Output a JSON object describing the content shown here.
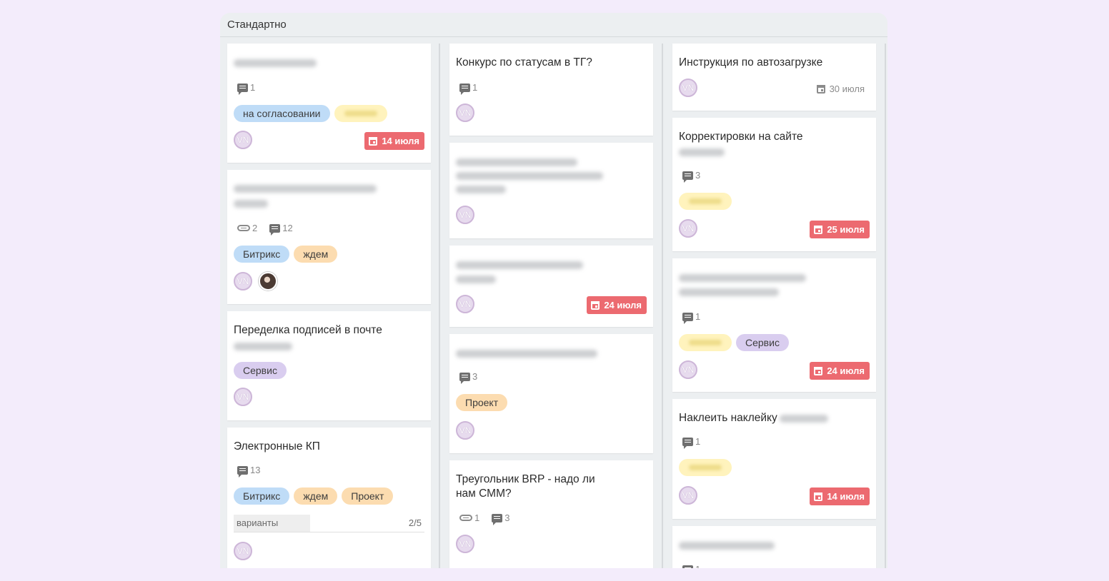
{
  "board": {
    "title": "Стандартно"
  },
  "icons": [
    "comment-icon",
    "paperclip-icon",
    "calendar-icon",
    "avatar"
  ],
  "colors": {
    "due_badge": "#ec6a70",
    "tag_blue": "#bfdcf7",
    "tag_orange": "#fcdcb0",
    "tag_purple": "#d9cdef",
    "tag_yellow": "#fff3bd"
  },
  "columns": [
    {
      "cards": [
        {
          "comments": "1",
          "tags": [
            "на согласовании"
          ],
          "avatar": "VN",
          "due": "14 июля"
        },
        {
          "attachments": "2",
          "comments": "12",
          "tags": [
            "Битрикс",
            "ждем"
          ],
          "avatar": "VN"
        },
        {
          "title": "Переделка подписей в почте",
          "tags": [
            "Сервис"
          ],
          "avatar": "VN"
        },
        {
          "title": "Электронные КП",
          "comments": "13",
          "tags": [
            "Битрикс",
            "ждем",
            "Проект"
          ],
          "checklist": {
            "label": "варианты",
            "count": "2/5",
            "progress": 0.4
          },
          "avatar": "VN"
        }
      ]
    },
    {
      "cards": [
        {
          "title": "Конкурс по статусам в ТГ?",
          "comments": "1",
          "avatar": "VN"
        },
        {
          "avatar": "VN"
        },
        {
          "avatar": "VN",
          "due": "24 июля"
        },
        {
          "comments": "3",
          "tags": [
            "Проект"
          ],
          "avatar": "VN"
        },
        {
          "title": "Треугольник BRP - надо ли нам СММ?",
          "attachments": "1",
          "comments": "3",
          "avatar": "VN"
        }
      ]
    },
    {
      "cards": [
        {
          "title": "Инструкция по автозагрузке",
          "avatar": "VN",
          "due": "30 июля"
        },
        {
          "title": "Корректировки на сайте",
          "comments": "3",
          "avatar": "VN",
          "due": "25 июля"
        },
        {
          "comments": "1",
          "tags": [
            "Сервис"
          ],
          "avatar": "VN",
          "due": "24 июля"
        },
        {
          "title": "Наклеить наклейку",
          "comments": "1",
          "avatar": "VN",
          "due": "14 июля"
        },
        {
          "comments": "1"
        }
      ]
    }
  ]
}
